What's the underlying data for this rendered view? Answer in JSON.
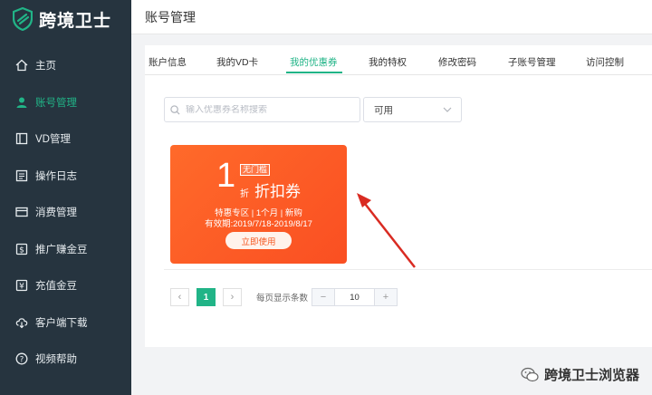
{
  "app": {
    "logo_text": "跨境卫士",
    "brand_color": "#21b487",
    "coupon_color": "#fa5a22"
  },
  "sidebar": {
    "items": [
      {
        "label": "主页",
        "icon": "home-icon",
        "active": false
      },
      {
        "label": "账号管理",
        "icon": "user-icon",
        "active": true
      },
      {
        "label": "VD管理",
        "icon": "vd-icon",
        "active": false
      },
      {
        "label": "操作日志",
        "icon": "log-icon",
        "active": false
      },
      {
        "label": "消费管理",
        "icon": "card-icon",
        "active": false
      },
      {
        "label": "推广赚金豆",
        "icon": "promote-icon",
        "active": false
      },
      {
        "label": "充值金豆",
        "icon": "yen-icon",
        "active": false
      },
      {
        "label": "客户端下载",
        "icon": "download-icon",
        "active": false
      },
      {
        "label": "视频帮助",
        "icon": "help-icon",
        "active": false
      }
    ]
  },
  "header": {
    "title": "账号管理"
  },
  "tabs": [
    {
      "label": "账户信息",
      "active": false
    },
    {
      "label": "我的VD卡",
      "active": false
    },
    {
      "label": "我的优惠券",
      "active": true
    },
    {
      "label": "我的特权",
      "active": false
    },
    {
      "label": "修改密码",
      "active": false
    },
    {
      "label": "子账号管理",
      "active": false
    },
    {
      "label": "访问控制",
      "active": false
    }
  ],
  "search": {
    "placeholder": "输入优惠券名称搜索",
    "icon": "search-icon"
  },
  "filter": {
    "selected": "可用",
    "icon": "chevron-down-icon"
  },
  "coupon": {
    "amount": "1",
    "unit": "折",
    "tag": "无门槛",
    "type": "折扣券",
    "description": "特惠专区 | 1个月 | 新购",
    "validity": "有效期:2019/7/18-2019/8/17",
    "button": "立即使用"
  },
  "pagination": {
    "prev": "‹",
    "current": "1",
    "next": "›",
    "page_size_label": "每页显示条数",
    "page_size": "10",
    "minus": "−",
    "plus": "+"
  },
  "watermark": {
    "text": "跨境卫士浏览器",
    "icon": "wechat-icon"
  }
}
